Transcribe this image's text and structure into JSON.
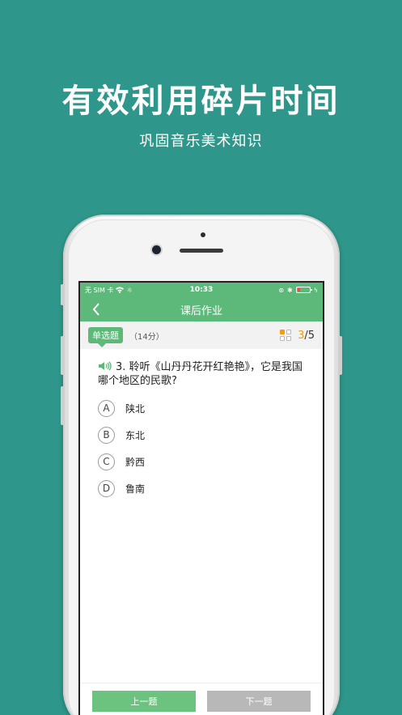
{
  "promo": {
    "title": "有效利用碎片时间",
    "subtitle": "巩固音乐美术知识"
  },
  "statusbar": {
    "carrier": "无 SIM 卡",
    "time": "10:33"
  },
  "navbar": {
    "title": "课后作业"
  },
  "question_bar": {
    "type": "单选题",
    "score": "（14分）",
    "current": "3",
    "total": "/5"
  },
  "question": {
    "text": "3. 聆听《山丹丹花开红艳艳》，它是我国哪个地区的民歌?"
  },
  "options": [
    {
      "letter": "A",
      "text": "陕北"
    },
    {
      "letter": "B",
      "text": "东北"
    },
    {
      "letter": "C",
      "text": "黔西"
    },
    {
      "letter": "D",
      "text": "鲁南"
    }
  ],
  "footer": {
    "prev_label": "上一题",
    "next_label": "下一题"
  },
  "colors": {
    "background": "#2e968a",
    "accent": "#5cb97a",
    "progress_current": "#f39c12",
    "next_disabled": "#b8b8b8"
  }
}
